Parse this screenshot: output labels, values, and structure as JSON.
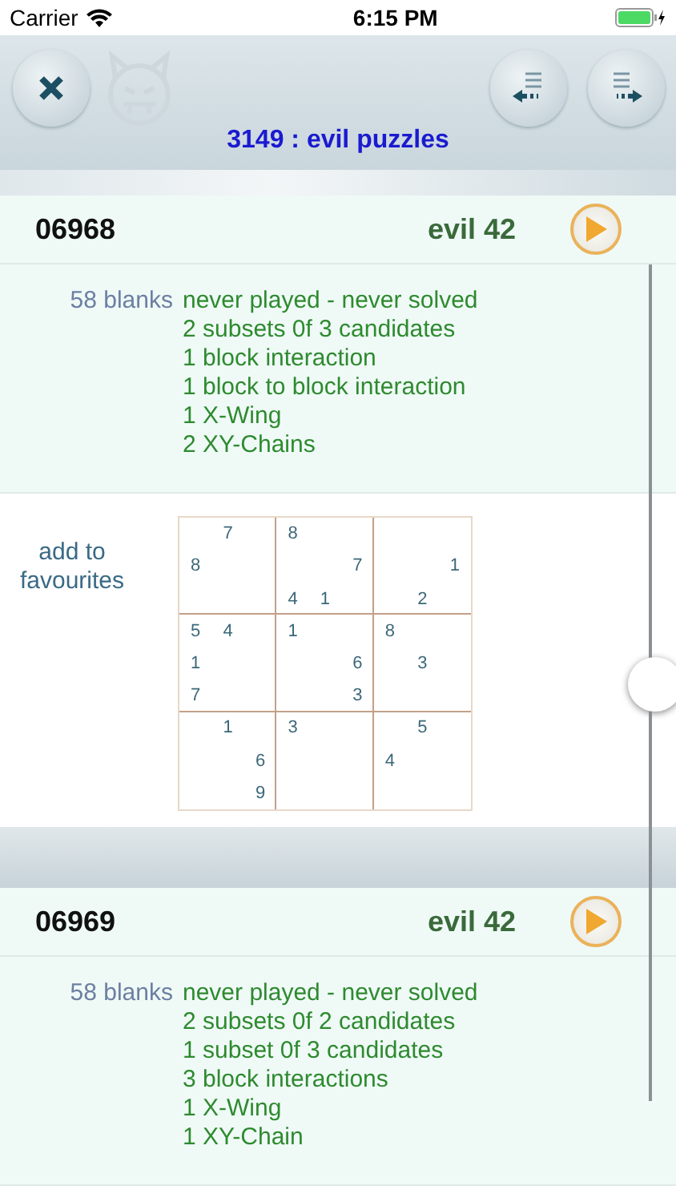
{
  "status_bar": {
    "carrier": "Carrier",
    "time": "6:15 PM"
  },
  "header": {
    "title": "3149 : evil puzzles"
  },
  "puzzles": [
    {
      "number": "06968",
      "rating": "evil 42",
      "blanks": "58 blanks",
      "techniques": [
        "never played - never solved",
        "2 subsets 0f 3 candidates",
        "1 block interaction",
        "1 block to block interaction",
        "1 X-Wing",
        "2 XY-Chains"
      ],
      "action": "add to\nfavourites",
      "grid": [
        [
          {
            "kind": "empty"
          },
          {
            "kind": "given",
            "value": "7"
          },
          {
            "kind": "empty"
          },
          {
            "kind": "given",
            "value": "8"
          },
          {
            "kind": "empty"
          },
          {
            "kind": "empty"
          },
          {
            "kind": "empty"
          },
          {
            "kind": "empty"
          },
          {
            "kind": "empty"
          }
        ],
        [
          {
            "kind": "given",
            "value": "8"
          },
          {
            "kind": "empty"
          },
          {
            "kind": "empty"
          },
          {
            "kind": "empty"
          },
          {
            "kind": "empty"
          },
          {
            "kind": "given",
            "value": "7"
          },
          {
            "kind": "empty"
          },
          {
            "kind": "empty"
          },
          {
            "kind": "given",
            "value": "1"
          }
        ],
        [
          {
            "kind": "empty"
          },
          {
            "kind": "empty"
          },
          {
            "kind": "empty"
          },
          {
            "kind": "given",
            "value": "4"
          },
          {
            "kind": "given",
            "value": "1"
          },
          {
            "kind": "empty"
          },
          {
            "kind": "empty"
          },
          {
            "kind": "given",
            "value": "2"
          },
          {
            "kind": "empty"
          }
        ],
        [
          {
            "kind": "given",
            "value": "5"
          },
          {
            "kind": "given",
            "value": "4"
          },
          {
            "kind": "empty"
          },
          {
            "kind": "given",
            "value": "1"
          },
          {
            "kind": "empty"
          },
          {
            "kind": "empty"
          },
          {
            "kind": "given",
            "value": "8"
          },
          {
            "kind": "empty"
          },
          {
            "kind": "empty"
          }
        ],
        [
          {
            "kind": "given",
            "value": "1"
          },
          {
            "kind": "empty"
          },
          {
            "kind": "empty"
          },
          {
            "kind": "empty"
          },
          {
            "kind": "empty"
          },
          {
            "kind": "given",
            "value": "6"
          },
          {
            "kind": "empty"
          },
          {
            "kind": "given",
            "value": "3"
          },
          {
            "kind": "empty"
          }
        ],
        [
          {
            "kind": "given",
            "value": "7"
          },
          {
            "kind": "empty"
          },
          {
            "kind": "empty"
          },
          {
            "kind": "empty"
          },
          {
            "kind": "empty"
          },
          {
            "kind": "given",
            "value": "3"
          },
          {
            "kind": "empty"
          },
          {
            "kind": "empty"
          },
          {
            "kind": "empty"
          }
        ],
        [
          {
            "kind": "empty"
          },
          {
            "kind": "given",
            "value": "1"
          },
          {
            "kind": "empty"
          },
          {
            "kind": "given",
            "value": "3"
          },
          {
            "kind": "empty"
          },
          {
            "kind": "empty"
          },
          {
            "kind": "empty"
          },
          {
            "kind": "given",
            "value": "5"
          },
          {
            "kind": "empty"
          }
        ],
        [
          {
            "kind": "empty"
          },
          {
            "kind": "empty"
          },
          {
            "kind": "given",
            "value": "6"
          },
          {
            "kind": "empty"
          },
          {
            "kind": "empty"
          },
          {
            "kind": "empty"
          },
          {
            "kind": "given",
            "value": "4"
          },
          {
            "kind": "empty"
          },
          {
            "kind": "empty"
          }
        ],
        [
          {
            "kind": "empty"
          },
          {
            "kind": "empty"
          },
          {
            "kind": "given",
            "value": "9"
          },
          {
            "kind": "empty"
          },
          {
            "kind": "empty"
          },
          {
            "kind": "empty"
          },
          {
            "kind": "empty"
          },
          {
            "kind": "empty"
          },
          {
            "kind": "empty"
          }
        ]
      ]
    },
    {
      "number": "06969",
      "rating": "evil 42",
      "blanks": "58 blanks",
      "techniques": [
        "never played - never solved",
        "2 subsets 0f 2 candidates",
        "1 subset 0f 3 candidates",
        "3 block interactions",
        "1 X-Wing",
        "1 XY-Chain"
      ]
    }
  ]
}
